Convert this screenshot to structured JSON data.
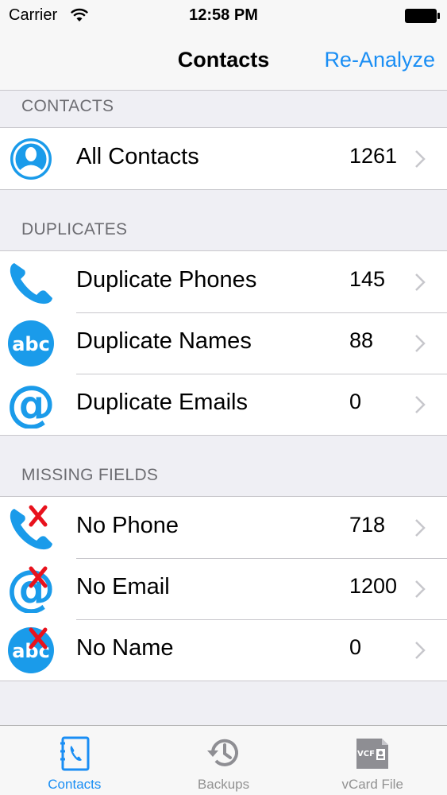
{
  "status": {
    "carrier": "Carrier",
    "time": "12:58 PM"
  },
  "nav": {
    "title": "Contacts",
    "right_action": "Re-Analyze"
  },
  "sections": [
    {
      "header": "CONTACTS",
      "rows": [
        {
          "label": "All Contacts",
          "count": "1261",
          "icon": "contact-person-icon"
        }
      ]
    },
    {
      "header": "DUPLICATES",
      "rows": [
        {
          "label": "Duplicate Phones",
          "count": "145",
          "icon": "phone-icon"
        },
        {
          "label": "Duplicate Names",
          "count": "88",
          "icon": "abc-icon"
        },
        {
          "label": "Duplicate Emails",
          "count": "0",
          "icon": "at-sign-icon"
        }
      ]
    },
    {
      "header": "MISSING FIELDS",
      "rows": [
        {
          "label": "No Phone",
          "count": "718",
          "icon": "phone-missing-icon"
        },
        {
          "label": "No Email",
          "count": "1200",
          "icon": "email-missing-icon"
        },
        {
          "label": "No Name",
          "count": "0",
          "icon": "name-missing-icon"
        }
      ]
    }
  ],
  "tabs": [
    {
      "label": "Contacts",
      "icon": "contacts-book-icon",
      "active": true
    },
    {
      "label": "Backups",
      "icon": "history-clock-icon",
      "active": false
    },
    {
      "label": "vCard File",
      "icon": "vcf-file-icon",
      "active": false
    },
    {
      "vcf_badge": "VCF"
    }
  ],
  "colors": {
    "accent": "#1a8ef4",
    "icon_blue": "#1a9bea",
    "cross_red": "#e8121d"
  }
}
